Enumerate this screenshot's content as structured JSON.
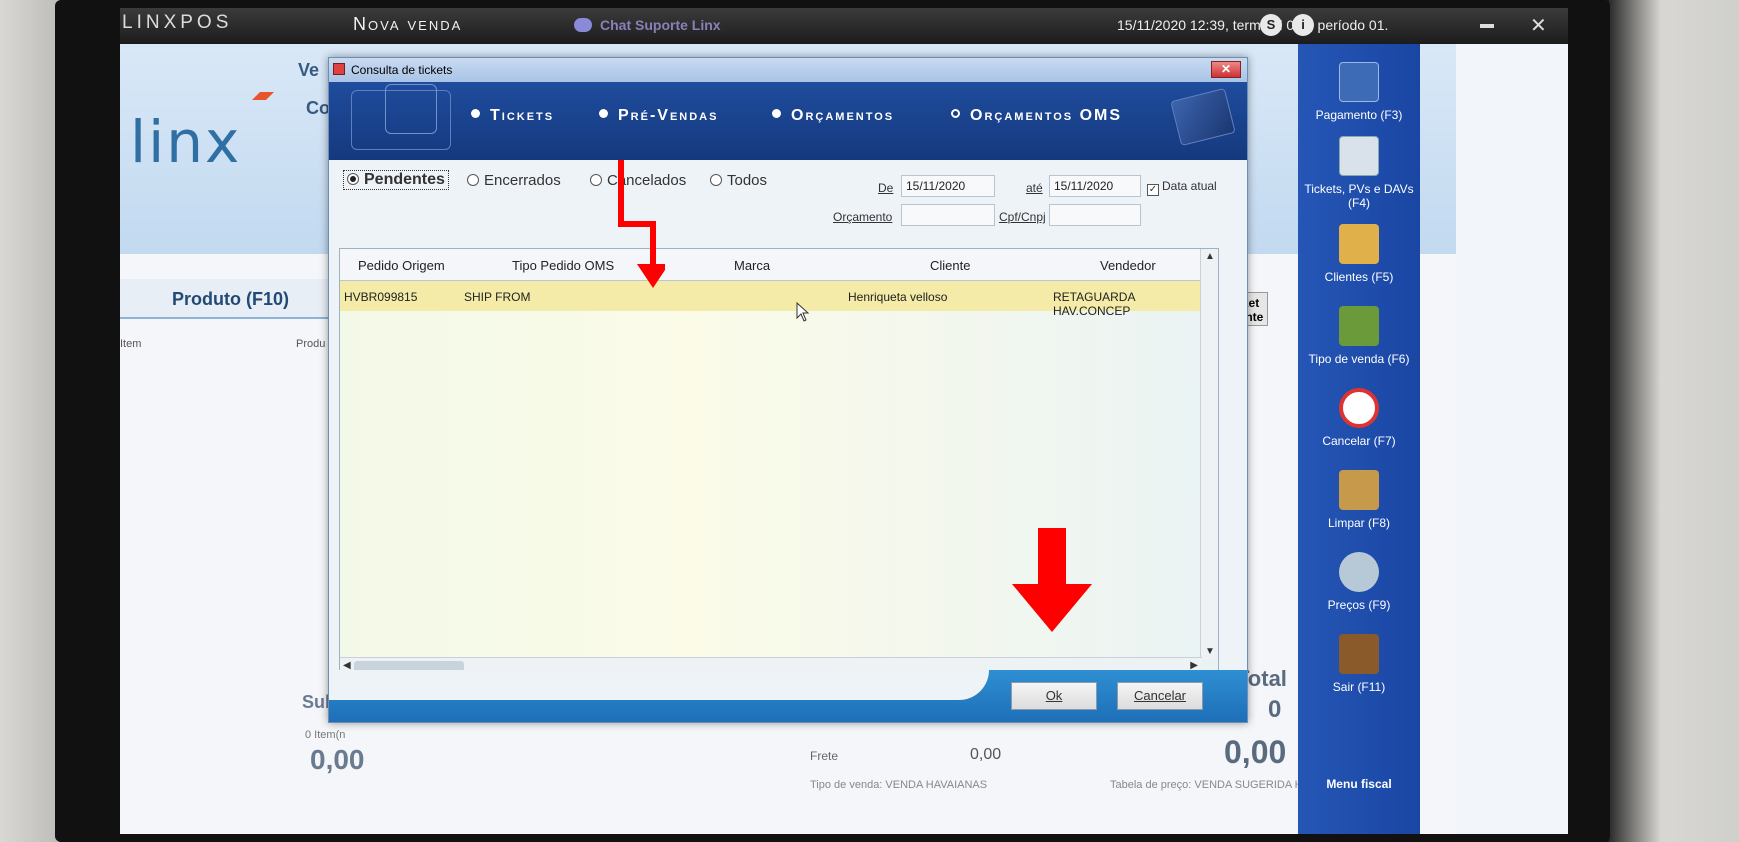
{
  "topbar": {
    "brand": "LINXPOS",
    "title": "Nova venda",
    "chat": "Chat Suporte Linx",
    "info": "15/11/2020 12:39, terminal 009, período 01."
  },
  "background_app": {
    "logo": "linx",
    "label_ve": "Ve",
    "label_co": "Co",
    "product_label": "Produto (F10)",
    "col_item": "Item",
    "col_produto": "Produ",
    "ticket_presente": "Ticket\nresente",
    "subtotal": "Subtota",
    "item_count": "0 Item(n",
    "subtotal_value": "0,00",
    "total_label": "Total",
    "total_count": "0",
    "total_value": "0,00",
    "frete_label": "Frete",
    "frete_value": "0,00",
    "bottom_text_1": "Tipo de venda:    VENDA HAVAIANAS",
    "bottom_text_2": "Tabela de preço:    VENDA SUGERIDA HAV"
  },
  "sidebar": {
    "items": [
      {
        "label": "Pagamento (F3)",
        "icon": "wallet-icon",
        "color": "#3d6bb5"
      },
      {
        "label": "Tickets, PVs e DAVs (F4)",
        "icon": "receipt-icon",
        "color": "#9ab2c8"
      },
      {
        "label": "Clientes (F5)",
        "icon": "clients-icon",
        "color": "#d9a640"
      },
      {
        "label": "Tipo de venda (F6)",
        "icon": "shopping-bag-icon",
        "color": "#5a8f3a"
      },
      {
        "label": "Cancelar (F7)",
        "icon": "cancel-icon",
        "color": "#d33"
      },
      {
        "label": "Limpar (F8)",
        "icon": "broom-icon",
        "color": "#b88a3a"
      },
      {
        "label": "Preços (F9)",
        "icon": "price-search-icon",
        "color": "#9fb7c8"
      },
      {
        "label": "Sair (F11)",
        "icon": "exit-door-icon",
        "color": "#8a5a2a"
      }
    ],
    "menu_fiscal": "Menu fiscal"
  },
  "dialog": {
    "title": "Consulta de tickets",
    "tabs": [
      {
        "label": "Tickets",
        "selected": false
      },
      {
        "label": "Pré-Vendas",
        "selected": false
      },
      {
        "label": "Orçamentos",
        "selected": false
      },
      {
        "label": "Orçamentos OMS",
        "selected": true
      }
    ],
    "status_filters": [
      {
        "label": "Pendentes",
        "selected": true
      },
      {
        "label": "Encerrados",
        "selected": false
      },
      {
        "label": "Cancelados",
        "selected": false
      },
      {
        "label": "Todos",
        "selected": false
      }
    ],
    "de_label": "De",
    "de_value": "15/11/2020",
    "ate_label": "até",
    "ate_value": "15/11/2020",
    "data_atual_label": "Data atual",
    "data_atual_checked": true,
    "orcamento_label": "Orçamento",
    "orcamento_value": "",
    "cpf_label": "Cpf/Cnpj",
    "cpf_value": "",
    "columns": [
      "Pedido Origem",
      "Tipo Pedido OMS",
      "Marca",
      "Cliente",
      "Vendedor"
    ],
    "rows": [
      {
        "pedido": "HVBR099815",
        "tipo": "SHIP FROM",
        "marca": "",
        "cliente": "Henriqueta velloso",
        "vendedor": "RETAGUARDA HAV.CONCEP"
      }
    ],
    "ok_label": "Ok",
    "cancel_label": "Cancelar"
  },
  "colors": {
    "dialog_banner": "#1f4c9d",
    "sidebar": "#2556b6",
    "selected_row": "#f5eba8",
    "annotation_arrow": "#ff0000"
  }
}
